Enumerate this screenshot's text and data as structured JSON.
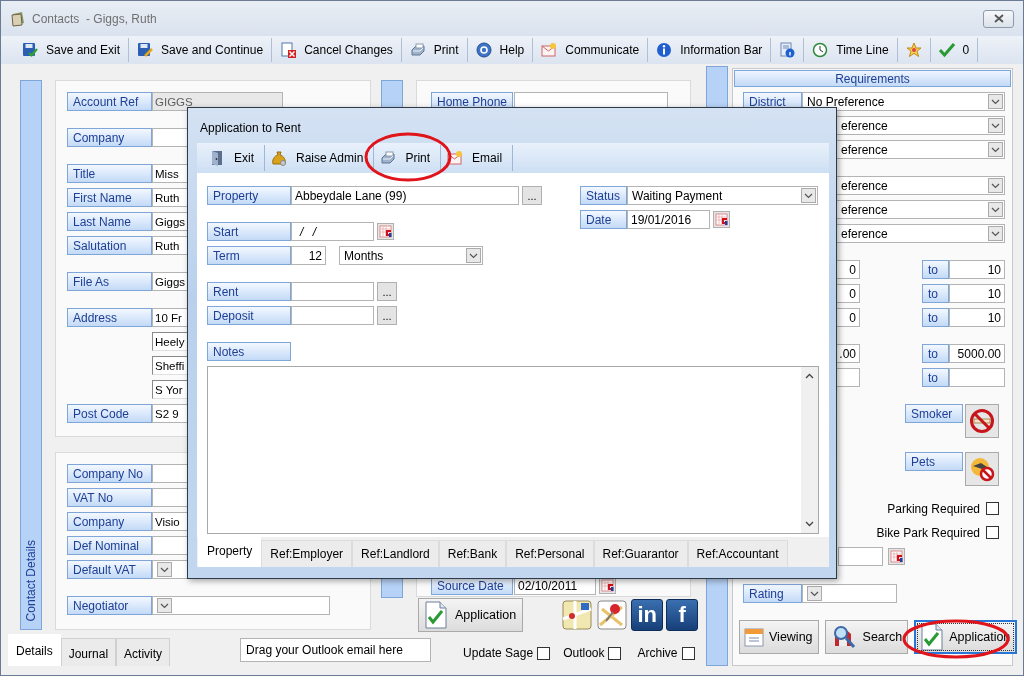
{
  "window": {
    "title": "Contacts  - Giggs, Ruth"
  },
  "toolbar": [
    {
      "kind": "save",
      "label": "Save and Exit"
    },
    {
      "kind": "continue",
      "label": "Save and Continue"
    },
    {
      "kind": "cancel",
      "label": "Cancel Changes"
    },
    {
      "kind": "print",
      "label": "Print"
    },
    {
      "kind": "help",
      "label": "Help"
    },
    {
      "kind": "communicate",
      "label": "Communicate"
    },
    {
      "kind": "info",
      "label": "Information Bar"
    },
    {
      "kind": "document"
    },
    {
      "kind": "timeline",
      "label": "Time Line"
    },
    {
      "kind": "star"
    },
    {
      "kind": "tick",
      "label": "0"
    }
  ],
  "contact_panel": {
    "side_tab": "Contact Details",
    "groups": [
      [
        {
          "kind": "readonly",
          "label": "Account Ref",
          "value": "GIGGS"
        }
      ],
      [
        {
          "kind": "text",
          "label": "Company"
        }
      ],
      [
        {
          "kind": "text",
          "label": "Title",
          "value": "Miss"
        },
        {
          "kind": "text",
          "label": "First Name",
          "value": "Ruth"
        },
        {
          "kind": "text",
          "label": "Last Name",
          "value": "Giggs"
        },
        {
          "kind": "text",
          "label": "Salutation",
          "value": "Ruth"
        }
      ],
      [
        {
          "kind": "text",
          "label": "File As",
          "value": "Giggs"
        }
      ],
      [
        {
          "kind": "text",
          "label": "Address",
          "value": "10 Fr"
        },
        {
          "kind": "line",
          "value": "Heely"
        },
        {
          "kind": "line",
          "value": "Sheffi"
        },
        {
          "kind": "line",
          "value": "S Yor"
        },
        {
          "kind": "text",
          "label": "Post Code",
          "value": "S2 9"
        }
      ]
    ]
  },
  "company_panel": {
    "groups": [
      [
        {
          "kind": "text",
          "label": "Company No"
        },
        {
          "kind": "text",
          "label": "VAT No"
        },
        {
          "kind": "text",
          "label": "Company",
          "value": "Visio"
        },
        {
          "kind": "text",
          "label": "Def Nominal"
        },
        {
          "kind": "smallcombo",
          "label": "Default VAT"
        }
      ],
      [
        {
          "kind": "combo",
          "label": "Negotiator"
        }
      ]
    ]
  },
  "middle": {
    "home_phone_label": "Home Phone",
    "source_date": {
      "label": "Source Date",
      "value": "02/10/2011"
    },
    "application_button": "Application",
    "links": [
      {
        "kind": "map"
      },
      {
        "kind": "pin"
      },
      {
        "kind": "tile",
        "text": "in"
      },
      {
        "kind": "tile",
        "text": "f"
      }
    ]
  },
  "requirements": {
    "title": "Requirements",
    "dropdown_groups": [
      [
        {
          "label": "District",
          "value": "No Preference"
        },
        {
          "value": "eference"
        },
        {
          "value": "eference"
        }
      ],
      [
        {
          "value": "eference"
        },
        {
          "value": "eference"
        },
        {
          "value": "eference"
        }
      ]
    ],
    "range_groups": [
      [
        {
          "from": "0",
          "to_label": "to",
          "to": "10"
        },
        {
          "from": "0",
          "to_label": "to",
          "to": "10"
        },
        {
          "from": "0",
          "to_label": "to",
          "to": "10"
        }
      ],
      [
        {
          "from": ".00",
          "to_label": "to",
          "to": "5000.00"
        },
        {
          "to_label": "to"
        }
      ]
    ],
    "toggles": [
      {
        "kind": "smoking",
        "label": "Smoker"
      },
      {
        "kind": "pets",
        "label": "Pets"
      }
    ],
    "checkboxes": [
      {
        "label": "Parking Required",
        "checked": false
      },
      {
        "label": "Bike Park Required",
        "checked": false
      }
    ],
    "rating": {
      "label": "Rating"
    },
    "buttons": [
      {
        "kind": "calendar",
        "label": "Viewing",
        "focused": false
      },
      {
        "kind": "search",
        "label": "Search",
        "focused": false
      },
      {
        "kind": "application",
        "label": "Application",
        "focused": true
      }
    ]
  },
  "bottom": {
    "tabs": [
      {
        "label": "Details",
        "selected": true
      },
      {
        "label": "Journal",
        "selected": false
      },
      {
        "label": "Activity",
        "selected": false
      }
    ],
    "email_drop": "Drag your Outlook email here",
    "checkboxes": [
      {
        "label": "Update Sage",
        "checked": false
      },
      {
        "label": "Outlook",
        "checked": false
      },
      {
        "label": "Archive",
        "checked": false
      }
    ]
  },
  "dialog": {
    "title": "Application to Rent",
    "toolbar": [
      {
        "kind": "exit",
        "label": "Exit"
      },
      {
        "kind": "admin",
        "label": "Raise Admin"
      },
      {
        "kind": "print",
        "label": "Print"
      },
      {
        "kind": "email",
        "label": "Email"
      }
    ],
    "property": {
      "label": "Property",
      "value": "Abbeydale Lane (99)",
      "button": "..."
    },
    "start": {
      "label": "Start",
      "value": "/ /"
    },
    "term": {
      "label": "Term",
      "value": "12",
      "unit": "Months"
    },
    "rent": {
      "label": "Rent",
      "button": "..."
    },
    "deposit": {
      "label": "Deposit",
      "button": "..."
    },
    "status": {
      "label": "Status",
      "value": "Waiting Payment"
    },
    "date": {
      "label": "Date",
      "value": "19/01/2016"
    },
    "notes": {
      "label": "Notes"
    },
    "tabs": [
      {
        "label": "Property",
        "selected": true
      },
      {
        "label": "Ref:Employer",
        "selected": false
      },
      {
        "label": "Ref:Landlord",
        "selected": false
      },
      {
        "label": "Ref:Bank",
        "selected": false
      },
      {
        "label": "Ref:Personal",
        "selected": false
      },
      {
        "label": "Ref:Guarantor",
        "selected": false
      },
      {
        "label": "Ref:Accountant",
        "selected": false
      }
    ]
  }
}
